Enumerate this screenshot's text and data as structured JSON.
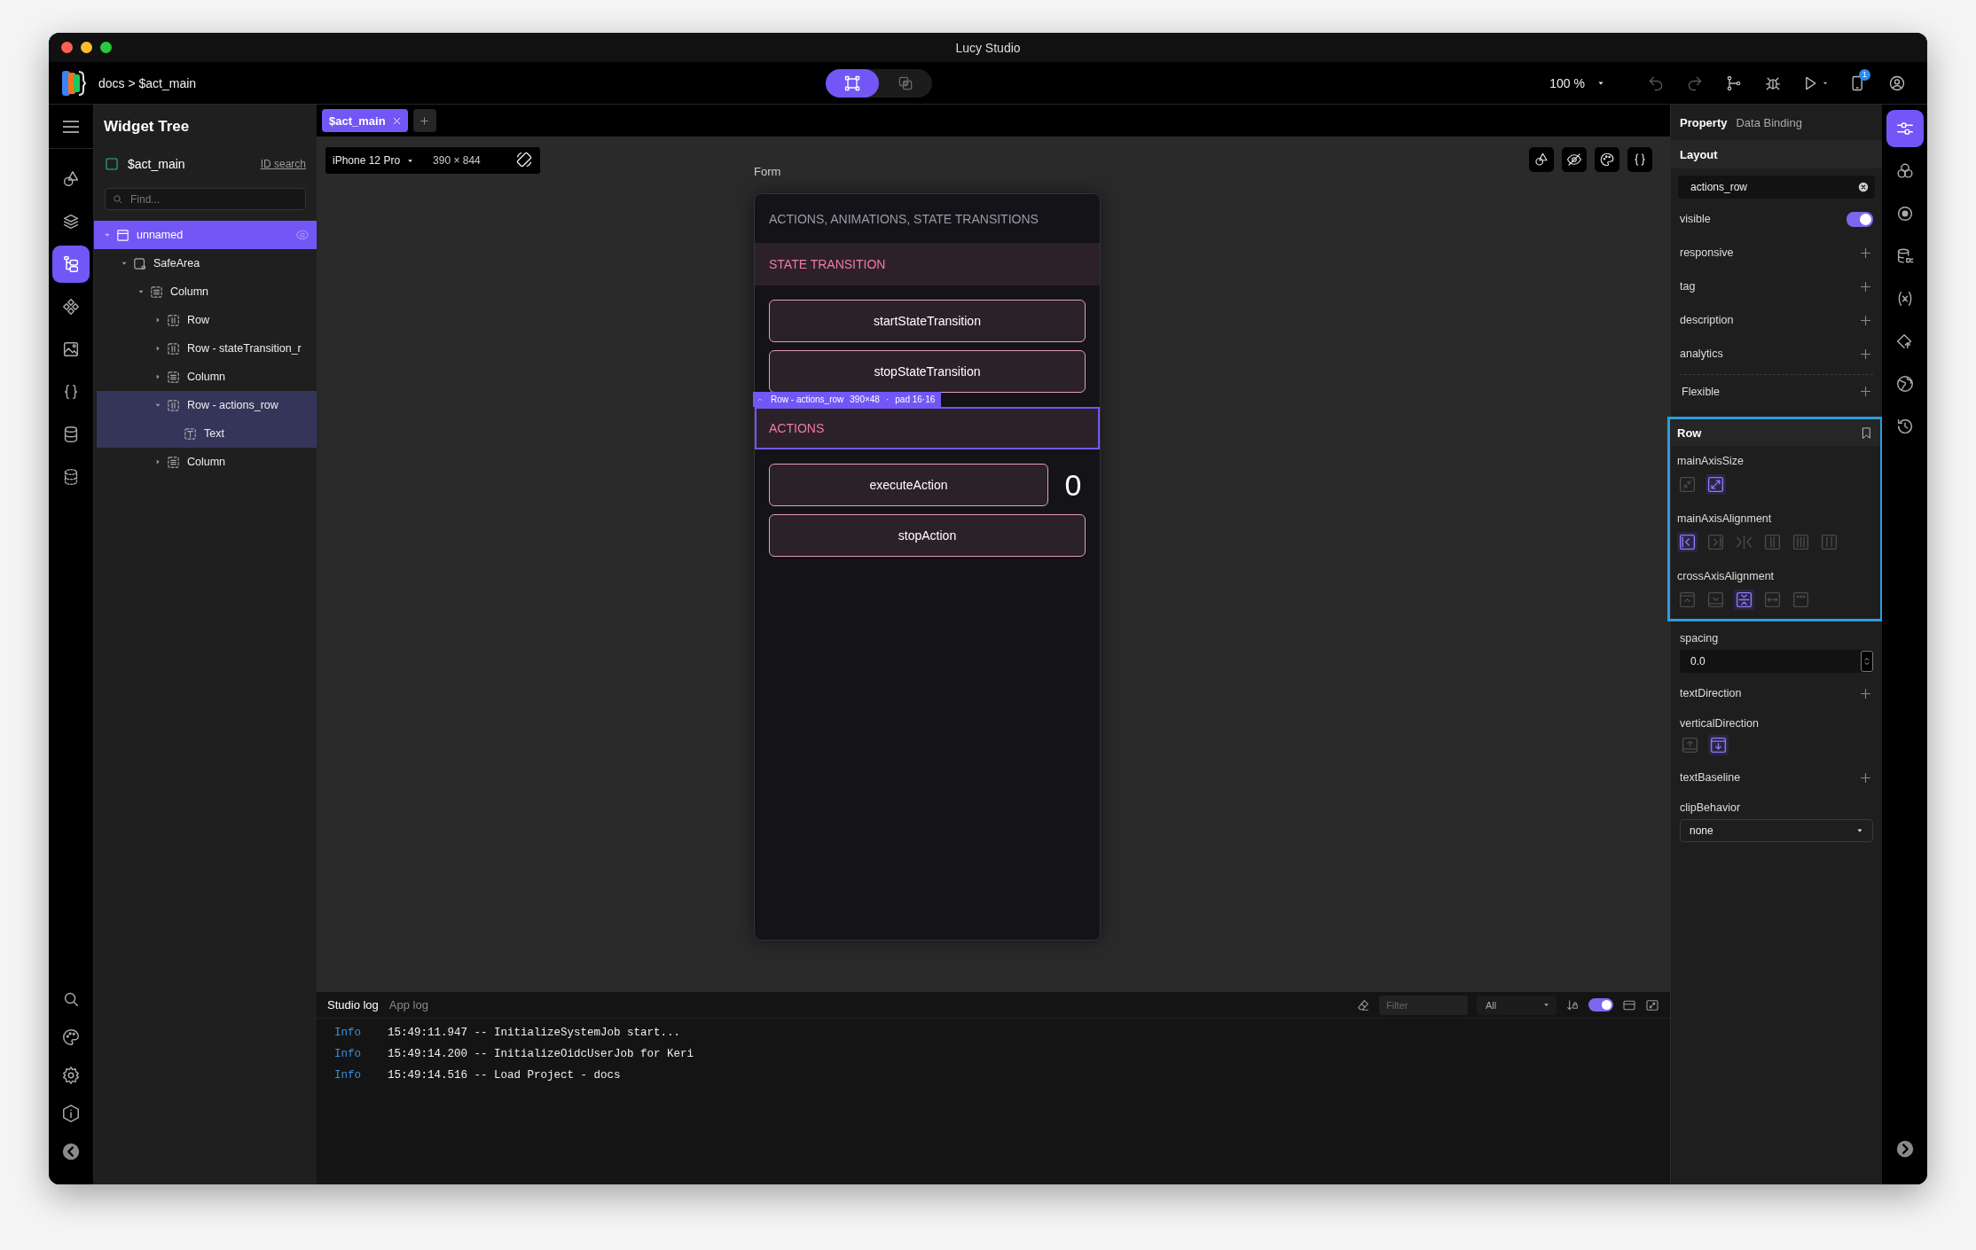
{
  "window": {
    "title": "Lucy Studio"
  },
  "toolbar": {
    "breadcrumb": "docs > $act_main",
    "modes": [
      {
        "kind": "design",
        "selected": true
      },
      {
        "kind": "preview",
        "selected": false
      }
    ],
    "zoom": "100 %",
    "notification_badge": "1"
  },
  "left_rail": {
    "top": [
      {
        "kind": "shapes",
        "selected": false
      },
      {
        "kind": "layers",
        "selected": false
      },
      {
        "kind": "tree",
        "selected": true
      },
      {
        "kind": "components",
        "selected": false
      },
      {
        "kind": "image",
        "selected": false
      },
      {
        "kind": "code",
        "selected": false
      },
      {
        "kind": "database",
        "selected": false
      },
      {
        "kind": "dataset",
        "selected": false
      }
    ],
    "bottom": [
      {
        "kind": "search"
      },
      {
        "kind": "palette"
      },
      {
        "kind": "settings"
      },
      {
        "kind": "info"
      },
      {
        "kind": "collapse"
      }
    ]
  },
  "widget_tree": {
    "title": "Widget Tree",
    "screen": "$act_main",
    "id_search": "ID search",
    "find_placeholder": "Find...",
    "items": [
      {
        "kind": "container",
        "label": "unnamed",
        "selected": true,
        "highlighted": false,
        "expanded": true,
        "children": [
          {
            "kind": "safearea",
            "label": "SafeArea",
            "selected": false,
            "highlighted": false,
            "expanded": true,
            "children": [
              {
                "kind": "column",
                "label": "Column",
                "selected": false,
                "highlighted": false,
                "expanded": true,
                "children": [
                  {
                    "kind": "row",
                    "label": "Row",
                    "selected": false,
                    "highlighted": false,
                    "expanded": false
                  },
                  {
                    "kind": "row",
                    "label": "Row - stateTransition_r",
                    "selected": false,
                    "highlighted": false,
                    "expanded": false
                  },
                  {
                    "kind": "column",
                    "label": "Column",
                    "selected": false,
                    "highlighted": false,
                    "expanded": false
                  },
                  {
                    "kind": "row",
                    "label": "Row - actions_row",
                    "selected": false,
                    "highlighted": true,
                    "expanded": true,
                    "children": [
                      {
                        "kind": "text",
                        "label": "Text",
                        "selected": false,
                        "highlighted": true
                      }
                    ]
                  },
                  {
                    "kind": "column",
                    "label": "Column",
                    "selected": false,
                    "highlighted": false,
                    "expanded": false
                  }
                ]
              }
            ]
          }
        ]
      }
    ]
  },
  "editor_tabs": [
    {
      "label": "$act_main",
      "selected": true
    }
  ],
  "device_bar": {
    "device": "iPhone 12 Pro",
    "size": "390 × 844"
  },
  "canvas_tools": [
    {
      "kind": "shapes"
    },
    {
      "kind": "hide"
    },
    {
      "kind": "palette"
    },
    {
      "kind": "code"
    }
  ],
  "form": {
    "label": "Form",
    "selection_badge": {
      "name": "Row - actions_row",
      "size": "390×48",
      "separator": "·",
      "padding": "pad 16·16"
    },
    "blocks": [
      {
        "kind": "title",
        "text": "ACTIONS, ANIMATIONS, STATE TRANSITIONS"
      },
      {
        "kind": "section",
        "text": "STATE TRANSITION",
        "highlighted": false
      },
      {
        "kind": "buttons",
        "items": [
          {
            "label": "startStateTransition"
          },
          {
            "label": "stopStateTransition"
          }
        ]
      },
      {
        "kind": "section",
        "text": "ACTIONS",
        "highlighted": true
      },
      {
        "kind": "buttons",
        "items": [
          {
            "label": "executeAction",
            "counter": "0"
          },
          {
            "label": "stopAction"
          }
        ]
      }
    ]
  },
  "log_panel": {
    "tabs": [
      {
        "label": "Studio log",
        "selected": true
      },
      {
        "label": "App log",
        "selected": false
      }
    ],
    "filter_placeholder": "Filter",
    "level_filter": "All",
    "autoscroll_on": true,
    "entries": [
      {
        "level": "Info",
        "message": "15:49:11.947 -- InitializeSystemJob start..."
      },
      {
        "level": "Info",
        "message": "15:49:14.200 -- InitializeOidcUserJob for Keri"
      },
      {
        "level": "Info",
        "message": "15:49:14.516 -- Load Project - docs"
      }
    ]
  },
  "property_panel": {
    "tabs": [
      {
        "label": "Property",
        "selected": true
      },
      {
        "label": "Data Binding",
        "selected": false
      }
    ],
    "section": "Layout",
    "name_value": "actions_row",
    "properties": [
      {
        "kind": "toggle",
        "label": "visible",
        "on": true
      },
      {
        "kind": "add",
        "label": "responsive"
      },
      {
        "kind": "add",
        "label": "tag"
      },
      {
        "kind": "add",
        "label": "description"
      },
      {
        "kind": "add",
        "label": "analytics"
      },
      {
        "kind": "add",
        "label": "Flexible",
        "separated": true
      },
      {
        "kind": "group",
        "label": "Row",
        "highlighted": true,
        "items": [
          {
            "kind": "options",
            "label": "mainAxisSize",
            "options": [
              {
                "kind": "shrink",
                "selected": false
              },
              {
                "kind": "expand",
                "selected": true
              }
            ]
          },
          {
            "kind": "options",
            "label": "mainAxisAlignment",
            "options": [
              {
                "kind": "start",
                "selected": true
              },
              {
                "kind": "end",
                "selected": false
              },
              {
                "kind": "center",
                "selected": false
              },
              {
                "kind": "between",
                "selected": false
              },
              {
                "kind": "around",
                "selected": false
              },
              {
                "kind": "evenly",
                "selected": false
              }
            ]
          },
          {
            "kind": "options",
            "label": "crossAxisAlignment",
            "options": [
              {
                "kind": "top",
                "selected": false
              },
              {
                "kind": "bottom",
                "selected": false
              },
              {
                "kind": "middle",
                "selected": true
              },
              {
                "kind": "stretch",
                "selected": false
              },
              {
                "kind": "baseline",
                "selected": false
              }
            ]
          }
        ]
      },
      {
        "kind": "number",
        "label": "spacing",
        "value": "0.0"
      },
      {
        "kind": "add",
        "label": "textDirection"
      },
      {
        "kind": "options",
        "label": "verticalDirection",
        "options": [
          {
            "kind": "up",
            "selected": false
          },
          {
            "kind": "down",
            "selected": true
          }
        ]
      },
      {
        "kind": "add",
        "label": "textBaseline"
      },
      {
        "kind": "select",
        "label": "clipBehavior",
        "value": "none"
      }
    ]
  },
  "right_rail": {
    "top": [
      {
        "kind": "sliders",
        "selected": true
      },
      {
        "kind": "circles",
        "selected": false
      },
      {
        "kind": "target",
        "selected": false
      },
      {
        "kind": "datasource",
        "selected": false
      },
      {
        "kind": "variable",
        "selected": false
      },
      {
        "kind": "tag",
        "selected": false
      },
      {
        "kind": "globe",
        "selected": false
      },
      {
        "kind": "history",
        "selected": false
      }
    ],
    "bottom": [
      {
        "kind": "expand"
      }
    ]
  }
}
